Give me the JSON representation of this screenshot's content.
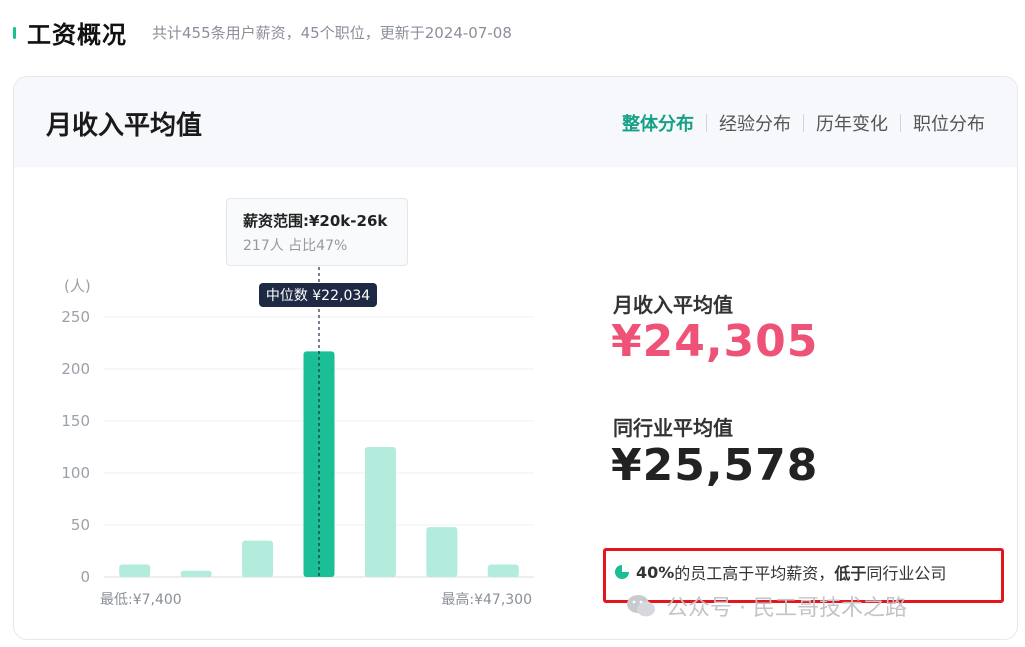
{
  "header": {
    "title": "工资概况",
    "subtitle": "共计455条用户薪资，45个职位，更新于2024-07-08"
  },
  "card": {
    "title": "月收入平均值",
    "tabs": [
      {
        "label": "整体分布",
        "active": true
      },
      {
        "label": "经验分布",
        "active": false
      },
      {
        "label": "历年变化",
        "active": false
      },
      {
        "label": "职位分布",
        "active": false
      }
    ]
  },
  "tooltip": {
    "line1": "薪资范围:¥20k-26k",
    "line2": "217人  占比47%"
  },
  "stats": {
    "avg_label": "月收入平均值",
    "avg_value": "¥24,305",
    "industry_label": "同行业平均值",
    "industry_value": "¥25,578"
  },
  "note": {
    "pct": "40%",
    "text1": "的员工高于平均薪资，",
    "bold": "低于",
    "text2": "同行业公司"
  },
  "watermark": {
    "text": "公众号 · 民工哥技术之路"
  },
  "colors": {
    "accent": "#1bbf95",
    "bar_light": "#b3ebdd",
    "bar_highlight": "#1bbf95",
    "avg_value": "#ee5277",
    "industry_value": "#222222",
    "median_badge": "#1e2a44",
    "box_red": "#e4161c"
  },
  "chart_data": {
    "type": "bar",
    "ylabel": "(人)",
    "ylim": [
      0,
      250
    ],
    "yticks": [
      "250",
      "200",
      "150",
      "100",
      "50",
      "0"
    ],
    "ytick_values": [
      250,
      200,
      150,
      100,
      50,
      0
    ],
    "values": [
      12,
      6,
      35,
      217,
      125,
      48,
      12
    ],
    "highlight_index": 3,
    "min_label": "最低:¥7,400",
    "max_label": "最高:¥47,300",
    "median_label": "中位数 ¥22,034",
    "grid": true
  }
}
